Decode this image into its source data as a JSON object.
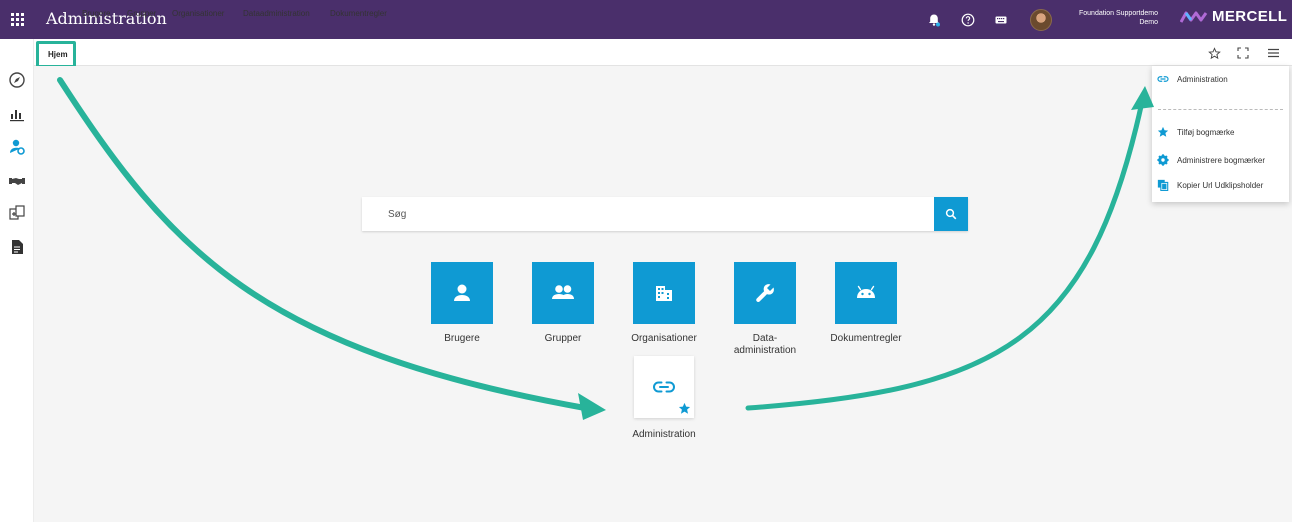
{
  "app": {
    "title": "Administration"
  },
  "user": {
    "name": "Foundation Supportdemo",
    "org": "Demo"
  },
  "brand": {
    "name": "MERCELL"
  },
  "tabs": [
    {
      "label": "Hjem"
    },
    {
      "label": "Brugere"
    },
    {
      "label": "Grupper"
    },
    {
      "label": "Organisationer"
    },
    {
      "label": "Dataadministration"
    },
    {
      "label": "Dokumentregler"
    }
  ],
  "search": {
    "placeholder": "Søg"
  },
  "tiles": [
    {
      "label": "Brugere",
      "icon": "person-icon"
    },
    {
      "label": "Grupper",
      "icon": "people-icon"
    },
    {
      "label": "Organisationer",
      "icon": "building-icon"
    },
    {
      "label_line1": "Data-",
      "label_line2": "administration",
      "icon": "wrench-icon"
    },
    {
      "label": "Dokumentregler",
      "icon": "android-icon"
    }
  ],
  "favorite": {
    "label": "Administration",
    "icon": "link-icon"
  },
  "menu": {
    "header": "Administration",
    "items": [
      {
        "label": "Tilføj bogmærke",
        "icon": "star-icon"
      },
      {
        "label": "Administrere bogmærker",
        "icon": "gear-icon"
      },
      {
        "label": "Kopier Url Udklipsholder",
        "icon": "copy-icon"
      }
    ]
  },
  "colors": {
    "topbar": "#4a2f6b",
    "accent": "#0f9ad3",
    "annotation": "#28b39a",
    "background": "#f5f5f5"
  }
}
